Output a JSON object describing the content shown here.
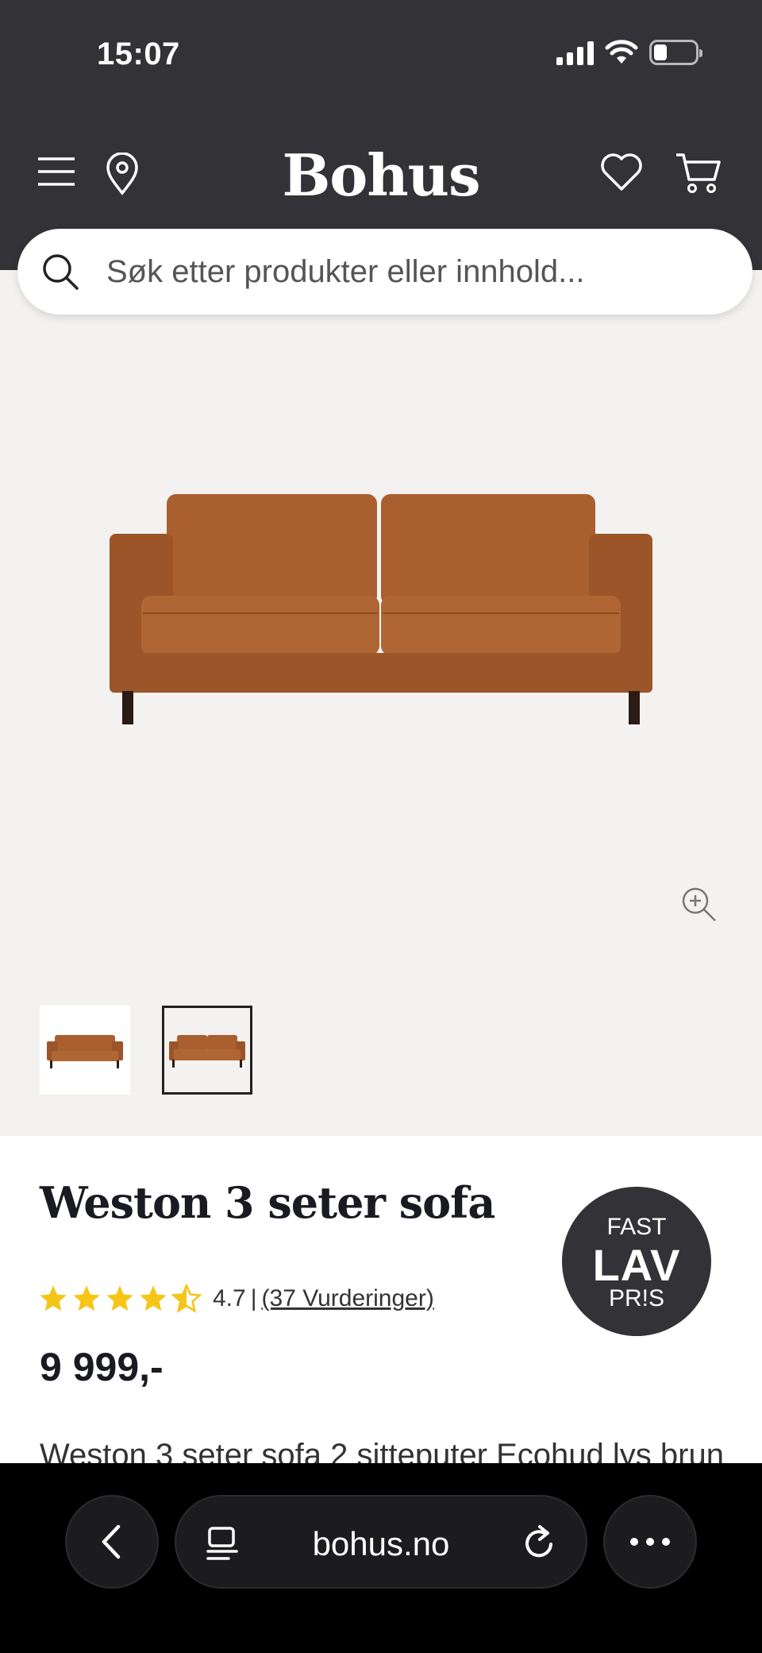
{
  "status_bar": {
    "time": "15:07"
  },
  "header": {
    "logo": "Bohus"
  },
  "search": {
    "placeholder": "Søk etter produkter eller innhold..."
  },
  "product": {
    "title": "Weston 3 seter sofa",
    "badge": {
      "line1": "FAST",
      "line2": "LAV",
      "line3": "PR!S"
    },
    "rating": {
      "value": "4.7",
      "separator": "|",
      "reviews_link": "(37 Vurderinger)",
      "stars": 4.5
    },
    "price": "9 999,-",
    "description": "Weston 3 seter sofa 2 sitteputer Ecohud lys brun"
  },
  "browser": {
    "url": "bohus.no"
  },
  "colors": {
    "header_bg": "#333337",
    "gallery_bg": "#f4f2f0",
    "star": "#f5c518",
    "sofa": "#a45a2c"
  }
}
